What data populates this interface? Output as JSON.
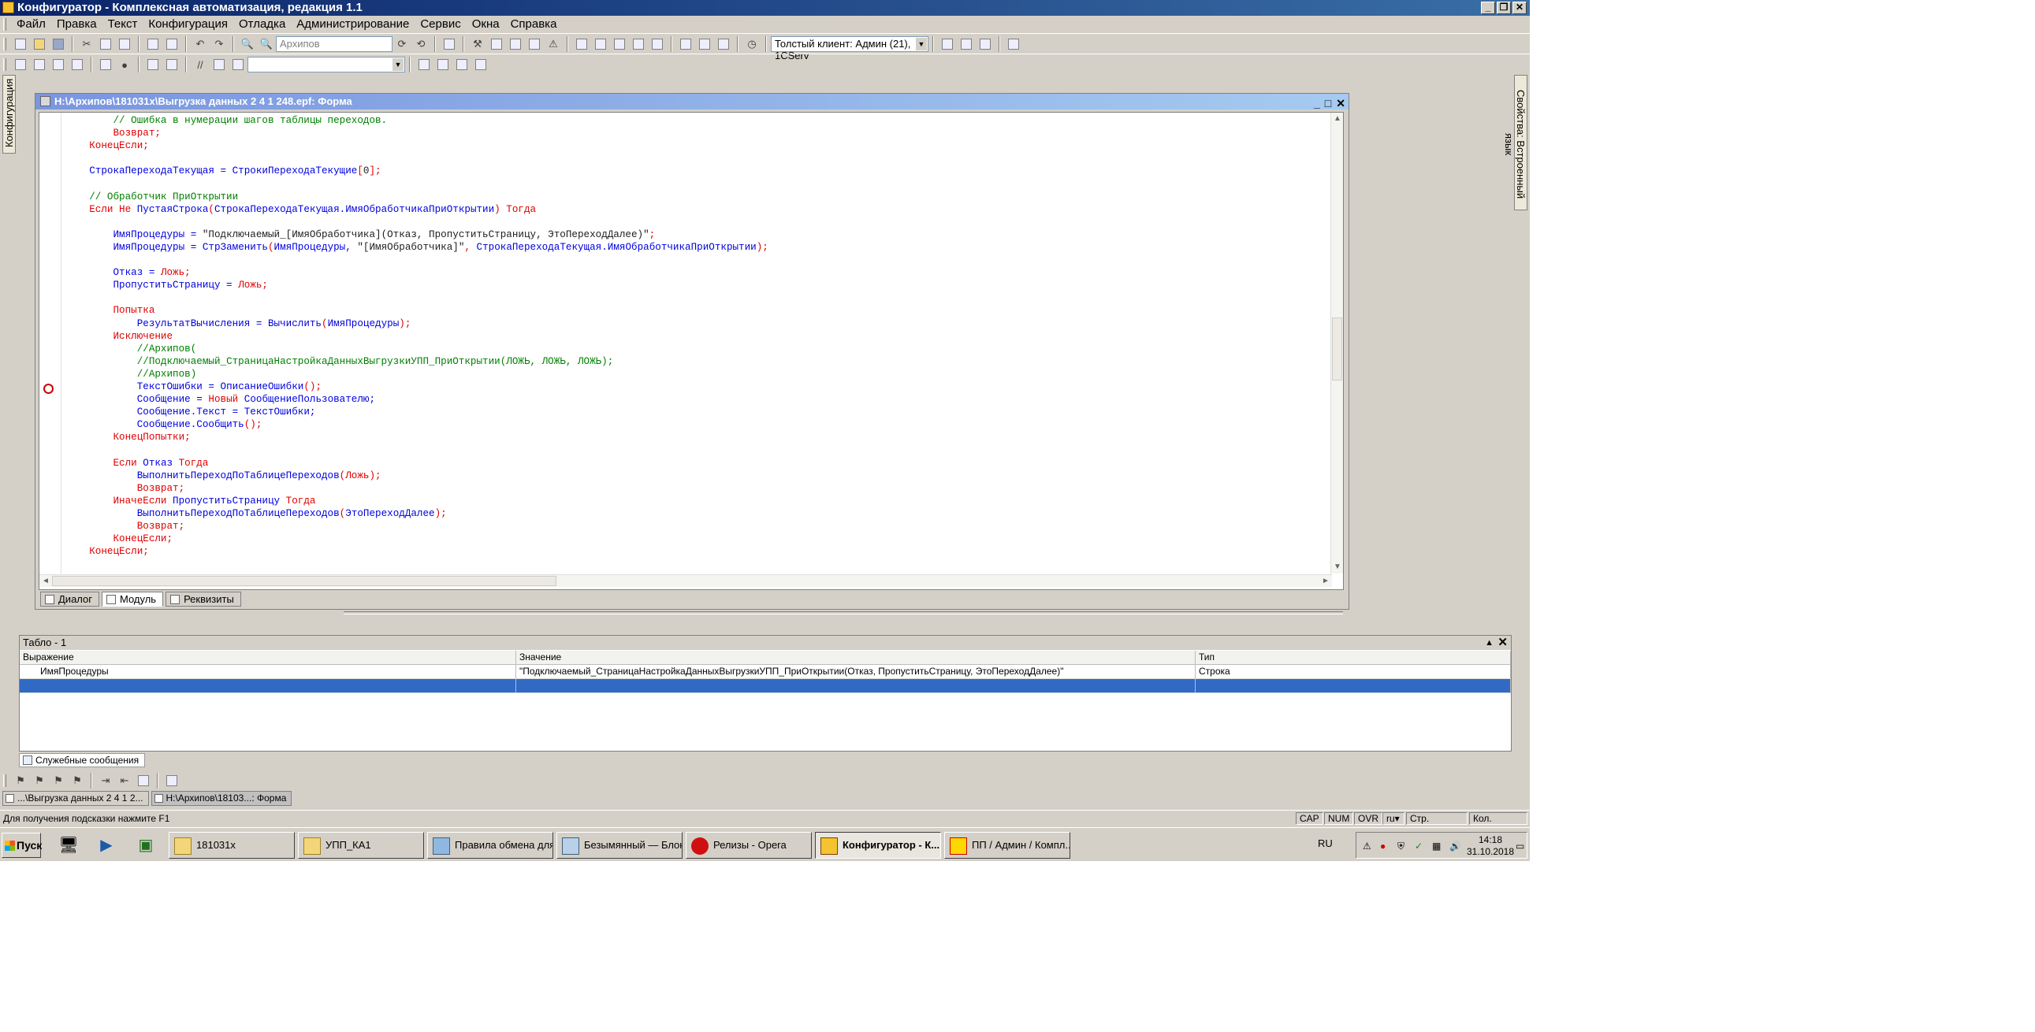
{
  "window": {
    "title": "Конфигуратор - Комплексная автоматизация, редакция 1.1"
  },
  "menu": [
    "Файл",
    "Правка",
    "Текст",
    "Конфигурация",
    "Отладка",
    "Администрирование",
    "Сервис",
    "Окна",
    "Справка"
  ],
  "toolbar": {
    "search_value": "Архипов",
    "client_combo": "Толстый клиент: Админ (21), 1CServ"
  },
  "left_panel": {
    "tab": "Конфигурация"
  },
  "right_panel": {
    "tab": "Свойства: Встроенный язык"
  },
  "document": {
    "title": "H:\\Архипов\\181031x\\Выгрузка данных 2 4 1 248.epf: Форма",
    "tabs": [
      "Диалог",
      "Модуль",
      "Реквизиты"
    ],
    "code_lines": [
      [
        [
          "        ",
          ""
        ],
        [
          "// Ошибка в нумерации шагов таблицы переходов.",
          "green"
        ]
      ],
      [
        [
          "        ",
          ""
        ],
        [
          "Возврат;",
          "red"
        ]
      ],
      [
        [
          "    ",
          ""
        ],
        [
          "КонецЕсли;",
          "red"
        ]
      ],
      [
        [
          "",
          ""
        ]
      ],
      [
        [
          "    ",
          ""
        ],
        [
          "СтрокаПереходаТекущая = СтрокиПереходаТекущие",
          "blue"
        ],
        [
          "[",
          "red"
        ],
        [
          "0",
          "dark"
        ],
        [
          "];",
          "red"
        ]
      ],
      [
        [
          "",
          ""
        ]
      ],
      [
        [
          "    ",
          ""
        ],
        [
          "// Обработчик ПриОткрытии",
          "green"
        ]
      ],
      [
        [
          "    ",
          ""
        ],
        [
          "Если Не ",
          "red"
        ],
        [
          "ПустаяСтрока",
          "blue"
        ],
        [
          "(",
          "red"
        ],
        [
          "СтрокаПереходаТекущая.ИмяОбработчикаПриОткрытии",
          "blue"
        ],
        [
          ") Тогда",
          "red"
        ]
      ],
      [
        [
          "",
          ""
        ]
      ],
      [
        [
          "        ",
          ""
        ],
        [
          "ИмяПроцедуры = ",
          "blue"
        ],
        [
          "\"Подключаемый_[ИмяОбработчика](Отказ, ПропуститьСтраницу, ЭтоПереходДалее)\"",
          "dark"
        ],
        [
          ";",
          "red"
        ]
      ],
      [
        [
          "        ",
          ""
        ],
        [
          "ИмяПроцедуры = ",
          "blue"
        ],
        [
          "СтрЗаменить",
          "blue"
        ],
        [
          "(",
          "red"
        ],
        [
          "ИмяПроцедуры, ",
          "blue"
        ],
        [
          "\"[ИмяОбработчика]\"",
          "dark"
        ],
        [
          ", ",
          "red"
        ],
        [
          "СтрокаПереходаТекущая.ИмяОбработчикаПриОткрытии",
          "blue"
        ],
        [
          ");",
          "red"
        ]
      ],
      [
        [
          "",
          ""
        ]
      ],
      [
        [
          "        ",
          ""
        ],
        [
          "Отказ = ",
          "blue"
        ],
        [
          "Ложь;",
          "red"
        ]
      ],
      [
        [
          "        ",
          ""
        ],
        [
          "ПропуститьСтраницу = ",
          "blue"
        ],
        [
          "Ложь;",
          "red"
        ]
      ],
      [
        [
          "",
          ""
        ]
      ],
      [
        [
          "        ",
          ""
        ],
        [
          "Попытка",
          "red"
        ]
      ],
      [
        [
          "            ",
          ""
        ],
        [
          "РезультатВычисления = ",
          "blue"
        ],
        [
          "Вычислить",
          "blue"
        ],
        [
          "(",
          "red"
        ],
        [
          "ИмяПроцедуры",
          "blue"
        ],
        [
          ");",
          "red"
        ]
      ],
      [
        [
          "        ",
          ""
        ],
        [
          "Исключение",
          "red"
        ]
      ],
      [
        [
          "            ",
          ""
        ],
        [
          "//Архипов(",
          "green"
        ]
      ],
      [
        [
          "            ",
          ""
        ],
        [
          "//Подключаемый_СтраницаНастройкаДанныхВыгрузкиУПП_ПриОткрытии(ЛОЖЬ, ЛОЖЬ, ЛОЖЬ);",
          "green"
        ]
      ],
      [
        [
          "            ",
          ""
        ],
        [
          "//Архипов)",
          "green"
        ]
      ],
      [
        [
          "            ",
          ""
        ],
        [
          "ТекстОшибки = ",
          "blue"
        ],
        [
          "ОписаниеОшибки",
          "blue"
        ],
        [
          "();",
          "red"
        ]
      ],
      [
        [
          "            ",
          ""
        ],
        [
          "Сообщение = ",
          "blue"
        ],
        [
          "Новый ",
          "red"
        ],
        [
          "СообщениеПользователю;",
          "blue"
        ]
      ],
      [
        [
          "            ",
          ""
        ],
        [
          "Сообщение.Текст = ",
          "blue"
        ],
        [
          "ТекстОшибки;",
          "blue"
        ]
      ],
      [
        [
          "            ",
          ""
        ],
        [
          "Сообщение.Сообщить",
          "blue"
        ],
        [
          "();",
          "red"
        ]
      ],
      [
        [
          "        ",
          ""
        ],
        [
          "КонецПопытки;",
          "red"
        ]
      ],
      [
        [
          "",
          ""
        ]
      ],
      [
        [
          "        ",
          ""
        ],
        [
          "Если ",
          "red"
        ],
        [
          "Отказ ",
          "blue"
        ],
        [
          "Тогда",
          "red"
        ]
      ],
      [
        [
          "            ",
          ""
        ],
        [
          "ВыполнитьПереходПоТаблицеПереходов",
          "blue"
        ],
        [
          "(",
          "red"
        ],
        [
          "Ложь",
          "red"
        ],
        [
          ");",
          "red"
        ]
      ],
      [
        [
          "            ",
          ""
        ],
        [
          "Возврат;",
          "red"
        ]
      ],
      [
        [
          "        ",
          ""
        ],
        [
          "ИначеЕсли ",
          "red"
        ],
        [
          "ПропуститьСтраницу ",
          "blue"
        ],
        [
          "Тогда",
          "red"
        ]
      ],
      [
        [
          "            ",
          ""
        ],
        [
          "ВыполнитьПереходПоТаблицеПереходов",
          "blue"
        ],
        [
          "(",
          "red"
        ],
        [
          "ЭтоПереходДалее",
          "blue"
        ],
        [
          ");",
          "red"
        ]
      ],
      [
        [
          "            ",
          ""
        ],
        [
          "Возврат;",
          "red"
        ]
      ],
      [
        [
          "        ",
          ""
        ],
        [
          "КонецЕсли;",
          "red"
        ]
      ],
      [
        [
          "    ",
          ""
        ],
        [
          "КонецЕсли;",
          "red"
        ]
      ]
    ]
  },
  "tablo": {
    "title": "Табло - 1",
    "headers": [
      "Выражение",
      "Значение",
      "Тип"
    ],
    "rows": [
      [
        "ИмяПроцедуры",
        "\"Подключаемый_СтраницаНастройкаДанныхВыгрузкиУПП_ПриОткрытии(Отказ, ПропуститьСтраницу, ЭтоПереходДалее)\"",
        "Строка"
      ]
    ]
  },
  "service_messages": "Служебные сообщения",
  "window_tabs": [
    "...\\Выгрузка данных 2 4 1 2...",
    "H:\\Архипов\\18103...: Форма"
  ],
  "statusbar": {
    "hint": "Для получения подсказки нажмите F1",
    "cap": "CAP",
    "num": "NUM",
    "ovr": "OVR",
    "lang": "ru",
    "str": "Стр.",
    "col": "Кол."
  },
  "taskbar": {
    "start": "Пуск",
    "tasks": [
      "181031x",
      "УПП_КА1",
      "Правила обмена для...",
      "Безымянный — Блок...",
      "Релизы - Opera",
      "Конфигуратор - К...",
      "ПП / Админ / Компл..."
    ],
    "active_task": "Конфигуратор - К...",
    "lang": "RU",
    "time": "14:18",
    "date": "31.10.2018"
  },
  "colors": {
    "comment": "#008000",
    "keyword": "#e00000",
    "identifier": "#0000e0",
    "selection": "#316ac5"
  }
}
